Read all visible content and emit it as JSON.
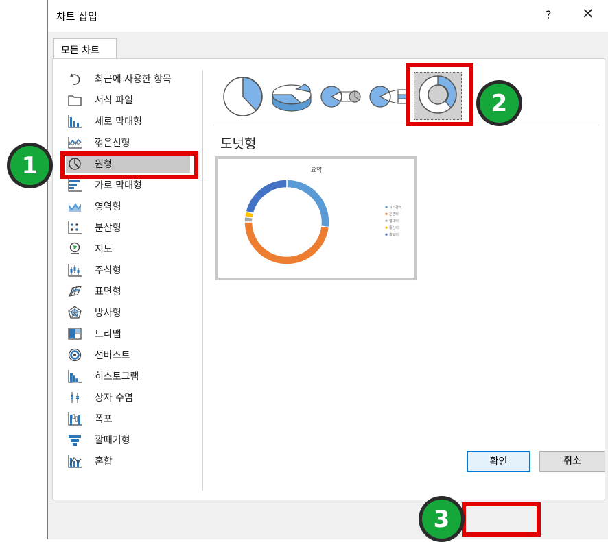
{
  "dialog": {
    "title": "차트 삽입",
    "help_glyph": "?",
    "close_glyph": "✕"
  },
  "tabs": [
    {
      "label": "모든 차트"
    }
  ],
  "chart_types": [
    {
      "label": "최근에 사용한 항목",
      "icon": "recent-icon"
    },
    {
      "label": "서식 파일",
      "icon": "folder-icon"
    },
    {
      "label": "세로 막대형",
      "icon": "column-chart-icon"
    },
    {
      "label": "꺾은선형",
      "icon": "line-chart-icon"
    },
    {
      "label": "원형",
      "icon": "pie-chart-icon",
      "selected": true
    },
    {
      "label": "가로 막대형",
      "icon": "bar-chart-icon"
    },
    {
      "label": "영역형",
      "icon": "area-chart-icon"
    },
    {
      "label": "분산형",
      "icon": "scatter-chart-icon"
    },
    {
      "label": "지도",
      "icon": "map-chart-icon"
    },
    {
      "label": "주식형",
      "icon": "stock-chart-icon"
    },
    {
      "label": "표면형",
      "icon": "surface-chart-icon"
    },
    {
      "label": "방사형",
      "icon": "radar-chart-icon"
    },
    {
      "label": "트리맵",
      "icon": "treemap-chart-icon"
    },
    {
      "label": "선버스트",
      "icon": "sunburst-chart-icon"
    },
    {
      "label": "히스토그램",
      "icon": "histogram-chart-icon"
    },
    {
      "label": "상자 수염",
      "icon": "box-whisker-chart-icon"
    },
    {
      "label": "폭포",
      "icon": "waterfall-chart-icon"
    },
    {
      "label": "깔때기형",
      "icon": "funnel-chart-icon"
    },
    {
      "label": "혼합",
      "icon": "combo-chart-icon"
    }
  ],
  "subtypes": [
    {
      "icon": "pie-subtype-icon"
    },
    {
      "icon": "3d-pie-subtype-icon"
    },
    {
      "icon": "pie-of-pie-subtype-icon"
    },
    {
      "icon": "bar-of-pie-subtype-icon"
    },
    {
      "icon": "donut-subtype-icon",
      "selected": true
    }
  ],
  "selected_subtype_name": "도넛형",
  "preview": {
    "title": "요약",
    "legend": [
      {
        "label": "기타경비",
        "color": "#5b9bd5"
      },
      {
        "label": "운영비",
        "color": "#ed7d31"
      },
      {
        "label": "접대비",
        "color": "#a5a5a5"
      },
      {
        "label": "통신비",
        "color": "#ffc000"
      },
      {
        "label": "홍보비",
        "color": "#4472c4"
      }
    ]
  },
  "chart_data": {
    "type": "pie",
    "variant": "donut",
    "title": "요약",
    "categories": [
      "기타경비",
      "운영비",
      "접대비",
      "통신비",
      "홍보비"
    ],
    "values": [
      0.27,
      0.48,
      0.02,
      0.02,
      0.21
    ],
    "colors": [
      "#5b9bd5",
      "#ed7d31",
      "#a5a5a5",
      "#ffc000",
      "#4472c4"
    ],
    "legend": "right"
  },
  "buttons": {
    "ok": "확인",
    "cancel": "취소"
  },
  "callouts": [
    "1",
    "2",
    "3"
  ]
}
